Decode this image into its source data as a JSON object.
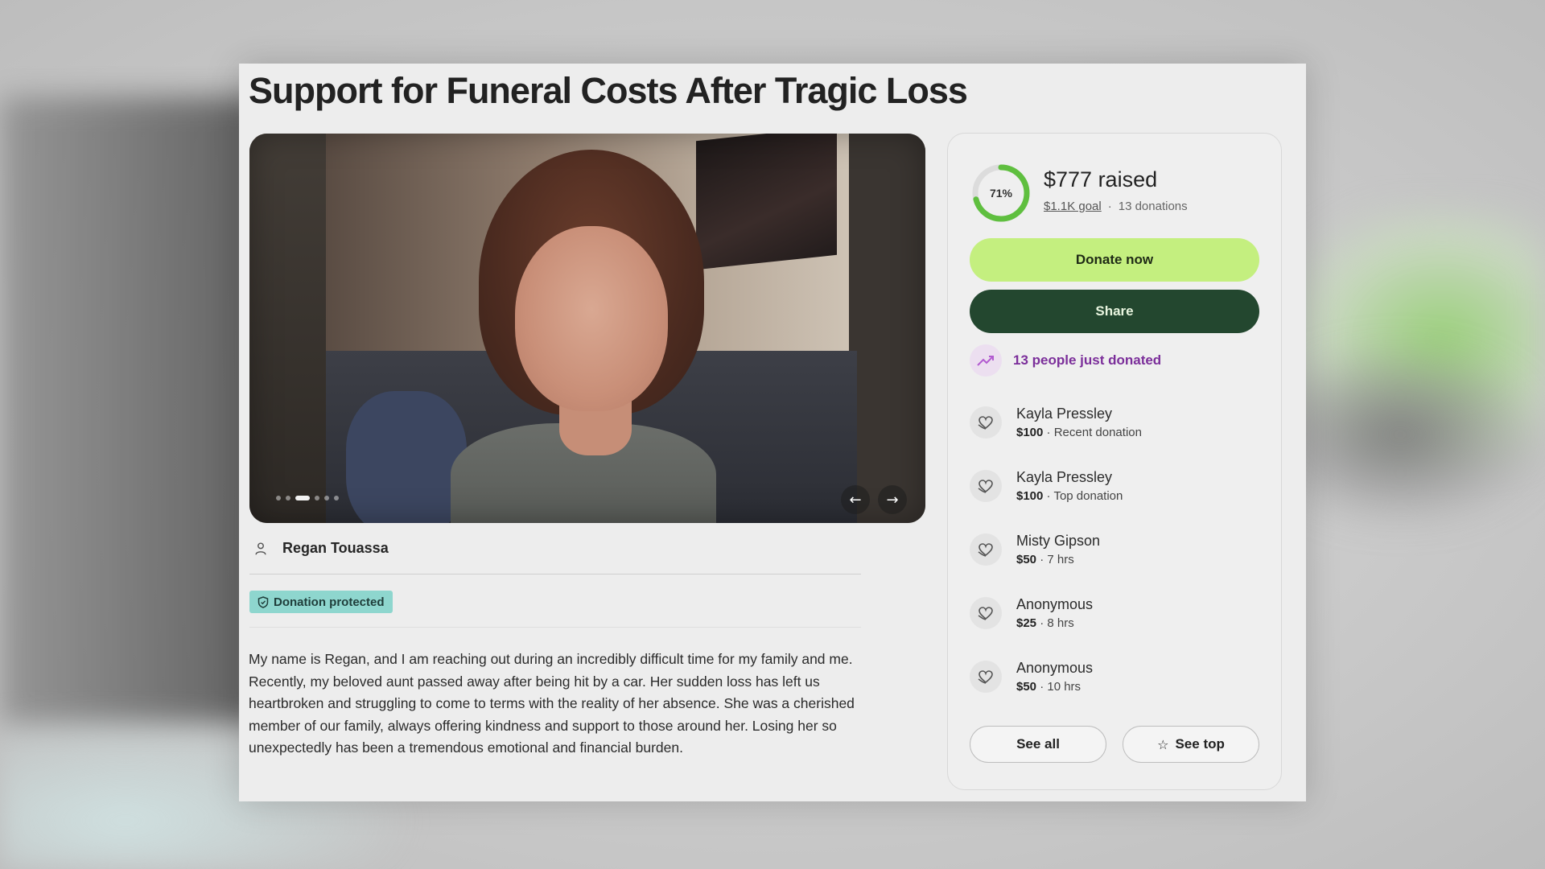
{
  "campaign": {
    "title": "Support for Funeral Costs After Tragic Loss",
    "organizer": "Regan Touassa",
    "badge": "Donation protected",
    "story": "My name is Regan, and I am reaching out during an incredibly difficult time for my family and me. Recently, my beloved aunt passed away after being hit by a car. Her sudden loss has left us heartbroken and struggling to come to terms with the reality of her absence. She was a cherished member of our family, always offering kindness and support to those around her. Losing her so unexpectedly has been a tremendous emotional and financial burden."
  },
  "gallery": {
    "slide_count": 6,
    "active_slide": 3,
    "prev_icon": "arrow-left-icon",
    "next_icon": "arrow-right-icon"
  },
  "progress": {
    "percent": 71,
    "percent_label": "71%",
    "raised_label": "$777 raised",
    "goal_label": "$1.1K goal",
    "separator": "·",
    "donations_label": "13 donations"
  },
  "actions": {
    "donate_label": "Donate now",
    "share_label": "Share"
  },
  "trending": {
    "label": "13 people just donated",
    "icon": "trending-up-icon"
  },
  "donations": [
    {
      "name": "Kayla Pressley",
      "amount": "$100",
      "detail": "· Recent donation"
    },
    {
      "name": "Kayla Pressley",
      "amount": "$100",
      "detail": "· Top donation"
    },
    {
      "name": "Misty Gipson",
      "amount": "$50",
      "detail": "· 7 hrs"
    },
    {
      "name": "Anonymous",
      "amount": "$25",
      "detail": "· 8 hrs"
    },
    {
      "name": "Anonymous",
      "amount": "$50",
      "detail": "· 10 hrs"
    }
  ],
  "list_actions": {
    "see_all_label": "See all",
    "see_top_label": "See top"
  },
  "colors": {
    "donate_bg": "#c4ef7f",
    "share_bg": "#23472f",
    "progress_ring": "#5fbf3f",
    "trending_text": "#7b2e9a",
    "badge_bg": "#8ed6ce"
  }
}
